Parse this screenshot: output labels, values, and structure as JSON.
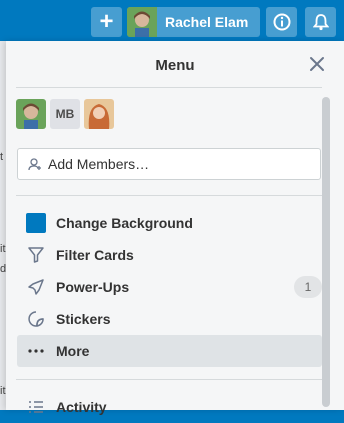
{
  "header": {
    "add_label": "+",
    "user_name": "Rachel Elam",
    "info_icon": "info-icon",
    "bell_icon": "bell-icon"
  },
  "menu": {
    "title": "Menu",
    "member_initials": "MB",
    "add_members_label": "Add Members…",
    "items": [
      {
        "label": "Change Background",
        "icon": "color-swatch-icon"
      },
      {
        "label": "Filter Cards",
        "icon": "filter-icon"
      },
      {
        "label": "Power-Ups",
        "icon": "rocket-icon",
        "badge": "1"
      },
      {
        "label": "Stickers",
        "icon": "sticker-icon"
      },
      {
        "label": "More",
        "icon": "more-icon"
      },
      {
        "label": "Activity",
        "icon": "activity-icon"
      }
    ]
  },
  "colors": {
    "header_bg": "#0079bf",
    "panel_bg": "#f5f6f7",
    "swatch": "#0079bf"
  }
}
